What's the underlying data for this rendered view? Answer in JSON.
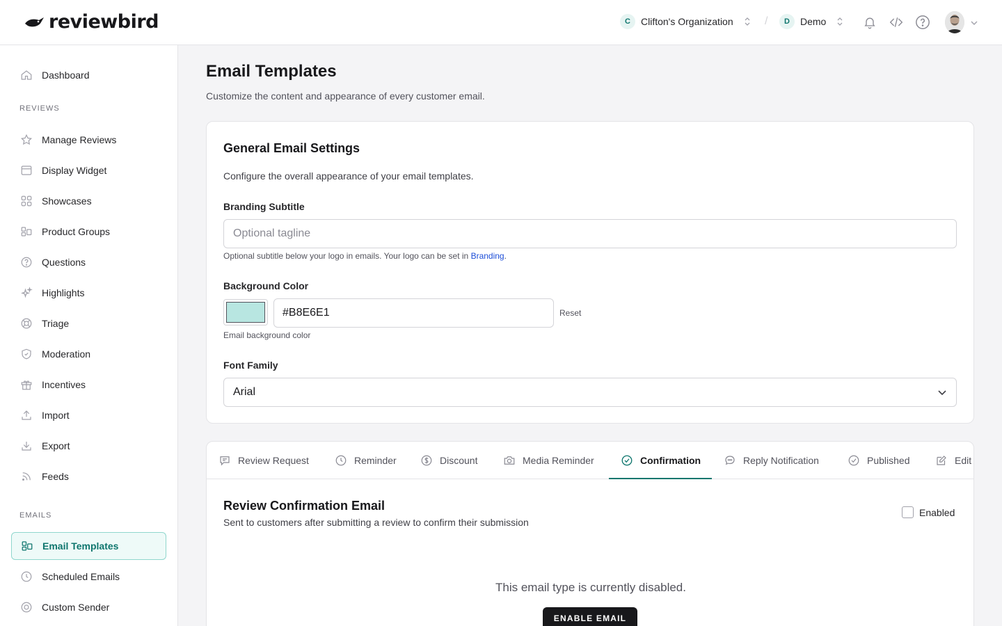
{
  "brand": {
    "name": "reviewbird"
  },
  "header": {
    "org": {
      "badge": "C",
      "name": "Clifton's Organization"
    },
    "separator": "/",
    "project": {
      "badge": "D",
      "name": "Demo"
    },
    "icons": [
      "bell-icon",
      "code-icon",
      "help-icon"
    ],
    "avatar": "user-avatar"
  },
  "sidebar": {
    "top_items": [
      {
        "label": "Dashboard",
        "icon": "home-icon"
      }
    ],
    "sections": [
      {
        "label": "REVIEWS",
        "items": [
          {
            "label": "Manage Reviews",
            "icon": "star-icon"
          },
          {
            "label": "Display Widget",
            "icon": "window-icon"
          },
          {
            "label": "Showcases",
            "icon": "grid-icon"
          },
          {
            "label": "Product Groups",
            "icon": "product-groups-icon"
          },
          {
            "label": "Questions",
            "icon": "question-icon"
          },
          {
            "label": "Highlights",
            "icon": "sparkles-icon"
          },
          {
            "label": "Triage",
            "icon": "lifebuoy-icon"
          },
          {
            "label": "Moderation",
            "icon": "shield-icon"
          },
          {
            "label": "Incentives",
            "icon": "gift-icon"
          },
          {
            "label": "Import",
            "icon": "upload-icon"
          },
          {
            "label": "Export",
            "icon": "download-icon"
          },
          {
            "label": "Feeds",
            "icon": "rss-icon"
          }
        ]
      },
      {
        "label": "EMAILS",
        "items": [
          {
            "label": "Email Templates",
            "icon": "templates-icon",
            "active": true
          },
          {
            "label": "Scheduled Emails",
            "icon": "clock-icon"
          },
          {
            "label": "Custom Sender",
            "icon": "at-icon"
          }
        ]
      }
    ]
  },
  "page": {
    "title": "Email Templates",
    "subtitle": "Customize the content and appearance of every customer email."
  },
  "general_settings": {
    "title": "General Email Settings",
    "description": "Configure the overall appearance of your email templates.",
    "branding_subtitle": {
      "label": "Branding Subtitle",
      "placeholder": "Optional tagline",
      "value": "",
      "help_prefix": "Optional subtitle below your logo in emails. Your logo can be set in ",
      "help_link": "Branding",
      "help_suffix": "."
    },
    "background_color": {
      "label": "Background Color",
      "value": "#B8E6E1",
      "swatch_color": "#B8E6E1",
      "reset_label": "Reset",
      "help": "Email background color"
    },
    "font_family": {
      "label": "Font Family",
      "selected": "Arial"
    }
  },
  "email_tabs": [
    {
      "label": "Review Request",
      "icon": "message-icon"
    },
    {
      "label": "Reminder",
      "icon": "clock-icon"
    },
    {
      "label": "Discount",
      "icon": "dollar-icon"
    },
    {
      "label": "Media Reminder",
      "icon": "camera-icon"
    },
    {
      "label": "Confirmation",
      "icon": "check-circle-icon",
      "active": true
    },
    {
      "label": "Reply Notification",
      "icon": "chat-icon"
    },
    {
      "label": "Published",
      "icon": "check-circle-icon"
    },
    {
      "label": "Edit",
      "icon": "edit-icon"
    }
  ],
  "confirmation": {
    "title": "Review Confirmation Email",
    "description": "Sent to customers after submitting a review to confirm their submission",
    "enabled_label": "Enabled",
    "enabled": false,
    "disabled_message": "This email type is currently disabled.",
    "enable_button": "ENABLE EMAIL"
  },
  "colors": {
    "accent": "#0f766e",
    "accent_border": "#8fd6cd",
    "accent_bg": "#eefaf8"
  }
}
